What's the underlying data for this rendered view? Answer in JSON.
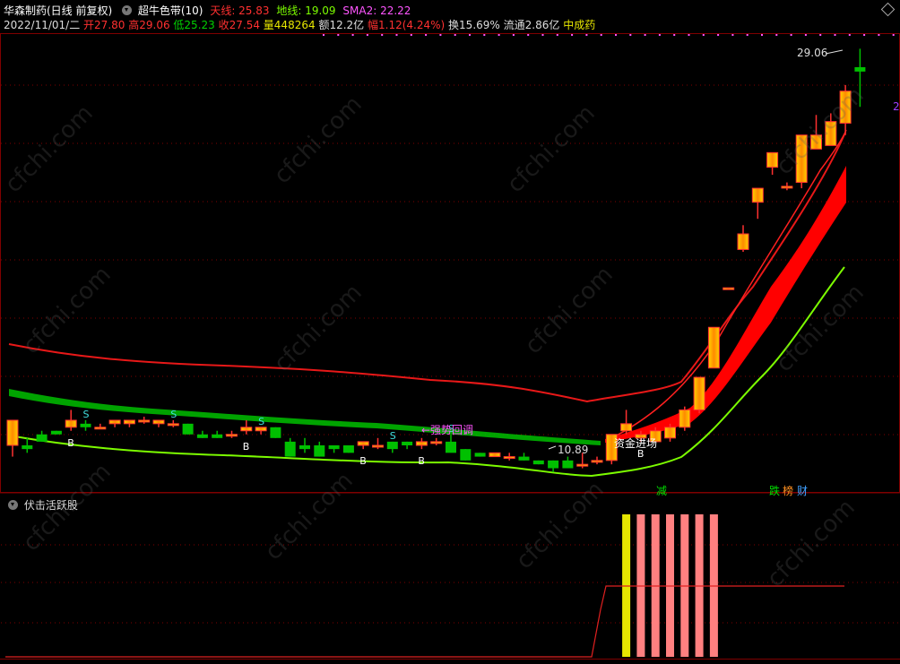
{
  "header": {
    "stock_name": "华森制药(日线 前复权)",
    "indicator_name": "超牛色带(10)",
    "tianxian_label": "天线: 25.83",
    "dixian_label": "地线: 19.09",
    "sma_label": "SMA2: 22.22",
    "date": "2022/11/01/二",
    "open": "开27.80",
    "high": "高29.06",
    "low": "低25.23",
    "close": "收27.54",
    "volume": "量448264",
    "amount": "额12.2亿",
    "change": "幅1.12(4.24%)",
    "turnover": "换15.69%",
    "float_cap": "流通2.86亿",
    "sector": "中成药"
  },
  "colors": {
    "up": "#ff3030",
    "down": "#00c000",
    "tianxian": "#e81818",
    "dixian": "#7cfc00",
    "sma": "#ff55ff",
    "yellow": "#e6e600",
    "pink_bar": "#ff8080",
    "grid": "#800000"
  },
  "annotations": {
    "high_price": "29.06",
    "low_price": "10.89",
    "capital_in": "资金进场",
    "strong_pullback": "←强势回调",
    "jian": "减",
    "die": "跌",
    "bang": "榜",
    "cai": "财",
    "side_char": "2"
  },
  "signals": {
    "b_label": "B",
    "s_label": "S"
  },
  "sub_panel": {
    "title": "伏击活跃股"
  },
  "watermark": "cfchi.com",
  "chart_data": {
    "type": "candlestick",
    "title": "华森制药(日线 前复权)",
    "candles": [
      {
        "o": 10.9,
        "h": 11.0,
        "l": 10.6,
        "c": 11.6
      },
      {
        "o": 10.9,
        "h": 11.1,
        "l": 10.7,
        "c": 10.8
      },
      {
        "o": 11.2,
        "h": 11.3,
        "l": 11.0,
        "c": 11.0
      },
      {
        "o": 11.3,
        "h": 11.3,
        "l": 11.2,
        "c": 11.2
      },
      {
        "o": 11.4,
        "h": 11.9,
        "l": 11.3,
        "c": 11.6
      },
      {
        "o": 11.5,
        "h": 11.6,
        "l": 11.3,
        "c": 11.4
      },
      {
        "o": 11.4,
        "h": 11.5,
        "l": 11.4,
        "c": 11.4
      },
      {
        "o": 11.5,
        "h": 11.6,
        "l": 11.4,
        "c": 11.6
      },
      {
        "o": 11.5,
        "h": 11.6,
        "l": 11.4,
        "c": 11.6
      },
      {
        "o": 11.6,
        "h": 11.7,
        "l": 11.5,
        "c": 11.6
      },
      {
        "o": 11.5,
        "h": 11.6,
        "l": 11.4,
        "c": 11.6
      },
      {
        "o": 11.5,
        "h": 11.6,
        "l": 11.4,
        "c": 11.5
      },
      {
        "o": 11.5,
        "h": 11.5,
        "l": 11.2,
        "c": 11.2
      },
      {
        "o": 11.2,
        "h": 11.3,
        "l": 11.1,
        "c": 11.1
      },
      {
        "o": 11.2,
        "h": 11.3,
        "l": 11.1,
        "c": 11.1
      },
      {
        "o": 11.2,
        "h": 11.3,
        "l": 11.1,
        "c": 11.2
      },
      {
        "o": 11.3,
        "h": 11.6,
        "l": 11.2,
        "c": 11.4
      },
      {
        "o": 11.3,
        "h": 11.4,
        "l": 11.2,
        "c": 11.4
      },
      {
        "o": 11.4,
        "h": 11.4,
        "l": 11.1,
        "c": 11.1
      },
      {
        "o": 11.0,
        "h": 11.1,
        "l": 10.6,
        "c": 10.6
      },
      {
        "o": 10.9,
        "h": 11.1,
        "l": 10.7,
        "c": 10.8
      },
      {
        "o": 10.9,
        "h": 11.0,
        "l": 10.6,
        "c": 10.6
      },
      {
        "o": 10.9,
        "h": 10.9,
        "l": 10.7,
        "c": 10.8
      },
      {
        "o": 10.9,
        "h": 10.9,
        "l": 10.7,
        "c": 10.7
      },
      {
        "o": 10.9,
        "h": 11.0,
        "l": 10.8,
        "c": 11.0
      },
      {
        "o": 10.9,
        "h": 11.1,
        "l": 10.8,
        "c": 10.9
      },
      {
        "o": 11.0,
        "h": 11.0,
        "l": 10.7,
        "c": 10.8
      },
      {
        "o": 11.0,
        "h": 11.0,
        "l": 10.8,
        "c": 10.9
      },
      {
        "o": 10.9,
        "h": 11.1,
        "l": 10.8,
        "c": 11.0
      },
      {
        "o": 11.0,
        "h": 11.1,
        "l": 10.9,
        "c": 11.0
      },
      {
        "o": 11.0,
        "h": 11.2,
        "l": 10.8,
        "c": 10.7
      },
      {
        "o": 10.8,
        "h": 10.8,
        "l": 10.5,
        "c": 10.5
      },
      {
        "o": 10.7,
        "h": 10.7,
        "l": 10.6,
        "c": 10.6
      },
      {
        "o": 10.6,
        "h": 10.7,
        "l": 10.6,
        "c": 10.7
      },
      {
        "o": 10.6,
        "h": 10.7,
        "l": 10.5,
        "c": 10.6
      },
      {
        "o": 10.6,
        "h": 10.7,
        "l": 10.5,
        "c": 10.5
      },
      {
        "o": 10.5,
        "h": 10.5,
        "l": 10.4,
        "c": 10.4
      },
      {
        "o": 10.5,
        "h": 10.5,
        "l": 10.2,
        "c": 10.3
      },
      {
        "o": 10.5,
        "h": 10.6,
        "l": 10.3,
        "c": 10.3
      },
      {
        "o": 10.4,
        "h": 10.7,
        "l": 10.3,
        "c": 10.4
      },
      {
        "o": 10.5,
        "h": 10.6,
        "l": 10.4,
        "c": 10.5
      },
      {
        "o": 10.5,
        "h": 11.2,
        "l": 10.4,
        "c": 11.2
      },
      {
        "o": 11.3,
        "h": 11.9,
        "l": 11.2,
        "c": 11.5
      },
      {
        "o": 11.1,
        "h": 11.3,
        "l": 11.0,
        "c": 11.2
      },
      {
        "o": 11.0,
        "h": 11.4,
        "l": 11.0,
        "c": 11.3
      },
      {
        "o": 11.1,
        "h": 11.5,
        "l": 11.0,
        "c": 11.4
      },
      {
        "o": 11.4,
        "h": 12.0,
        "l": 11.3,
        "c": 11.9
      },
      {
        "o": 11.9,
        "h": 12.9,
        "l": 11.8,
        "c": 12.9
      },
      {
        "o": 13.2,
        "h": 14.6,
        "l": 13.2,
        "c": 14.6
      },
      {
        "o": 16.1,
        "h": 16.1,
        "l": 16.1,
        "c": 16.1
      },
      {
        "o": 17.7,
        "h": 18.8,
        "l": 17.6,
        "c": 18.4
      },
      {
        "o": 19.9,
        "h": 20.4,
        "l": 19.1,
        "c": 20.6
      },
      {
        "o": 21.7,
        "h": 22.5,
        "l": 21.3,
        "c": 22.5
      },
      {
        "o": 20.7,
        "h": 20.9,
        "l": 20.5,
        "c": 20.7
      },
      {
        "o": 20.9,
        "h": 23.5,
        "l": 20.6,
        "c": 23.5
      },
      {
        "o": 22.7,
        "h": 24.7,
        "l": 22.7,
        "c": 23.5
      },
      {
        "o": 22.9,
        "h": 24.8,
        "l": 22.9,
        "c": 24.3
      },
      {
        "o": 24.2,
        "h": 26.6,
        "l": 23.5,
        "c": 26.2
      },
      {
        "o": 27.8,
        "h": 29.1,
        "l": 25.2,
        "c": 27.5
      }
    ],
    "tianxian_label": "天线: 25.83",
    "dixian_label": "地线: 19.09",
    "sma_label": "SMA2: 22.22",
    "max_label": "29.06",
    "min_label": "10.89",
    "buy_signal_candles": [
      4,
      16,
      24,
      28,
      43
    ],
    "sell_signal_candles": [
      5,
      11,
      17,
      26,
      30
    ],
    "sub_bars": [
      {
        "candle": 42,
        "color": "yellow"
      },
      {
        "candle": 43,
        "color": "pink"
      },
      {
        "candle": 44,
        "color": "pink"
      },
      {
        "candle": 45,
        "color": "pink"
      },
      {
        "candle": 46,
        "color": "pink"
      },
      {
        "candle": 47,
        "color": "pink"
      },
      {
        "candle": 48,
        "color": "pink"
      }
    ]
  }
}
